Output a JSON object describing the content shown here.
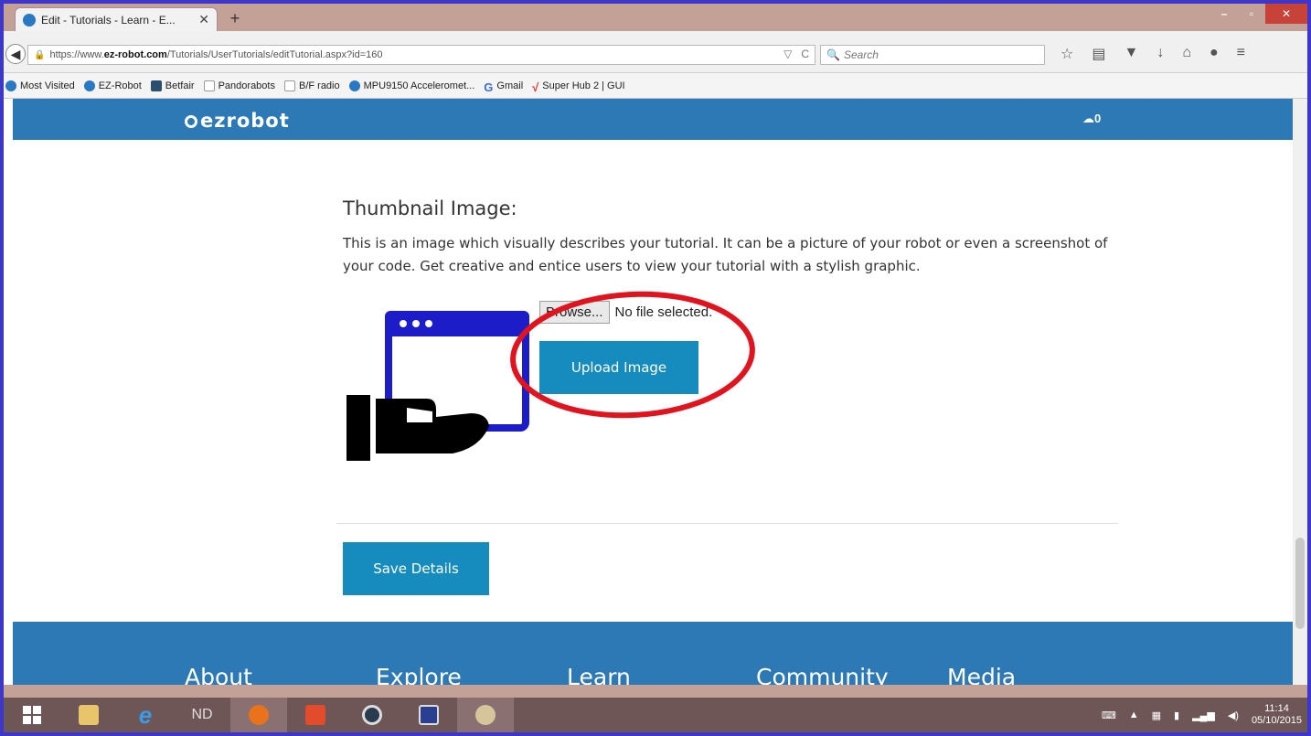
{
  "browser": {
    "tab_title": "Edit - Tutorials - Learn - E...",
    "tab_close": "✕",
    "new_tab": "+",
    "window_minimize": "–",
    "window_maximize": "▫",
    "window_close": "✕",
    "url_prefix": "https://www.",
    "url_domain": "ez-robot.com",
    "url_path": "/Tutorials/UserTutorials/editTutorial.aspx?id=160",
    "search_placeholder": "Search",
    "bookmarks": [
      {
        "label": "Most Visited",
        "icon": "bookmark-folder-icon"
      },
      {
        "label": "EZ-Robot",
        "icon": "ezrobot-icon"
      },
      {
        "label": "Betfair",
        "icon": "betfair-icon"
      },
      {
        "label": "Pandorabots",
        "icon": "page-icon"
      },
      {
        "label": "B/F radio",
        "icon": "page-icon"
      },
      {
        "label": "MPU9150 Acceleromet...",
        "icon": "ezrobot-icon"
      },
      {
        "label": "Gmail",
        "icon": "google-icon"
      },
      {
        "label": "Super Hub 2 | GUI",
        "icon": "check-icon"
      }
    ]
  },
  "site": {
    "logo": "ezrobot",
    "cart_count": "0",
    "section_title": "Thumbnail Image:",
    "section_desc": "This is an image which visually describes your tutorial. It can be a picture of your robot or even a screenshot of your code. Get creative and entice users to view your tutorial with a stylish graphic.",
    "browse_label": "Browse...",
    "file_status": "No file selected.",
    "upload_label": "Upload Image",
    "save_label": "Save Details",
    "footer_nav": [
      "About",
      "Explore",
      "Learn",
      "Community",
      "Media"
    ]
  },
  "taskbar": {
    "time": "11:14",
    "date": "05/10/2015"
  },
  "colors": {
    "header_blue": "#2c79b6",
    "button_blue": "#168bbd",
    "annotation_red": "#e0141e"
  }
}
